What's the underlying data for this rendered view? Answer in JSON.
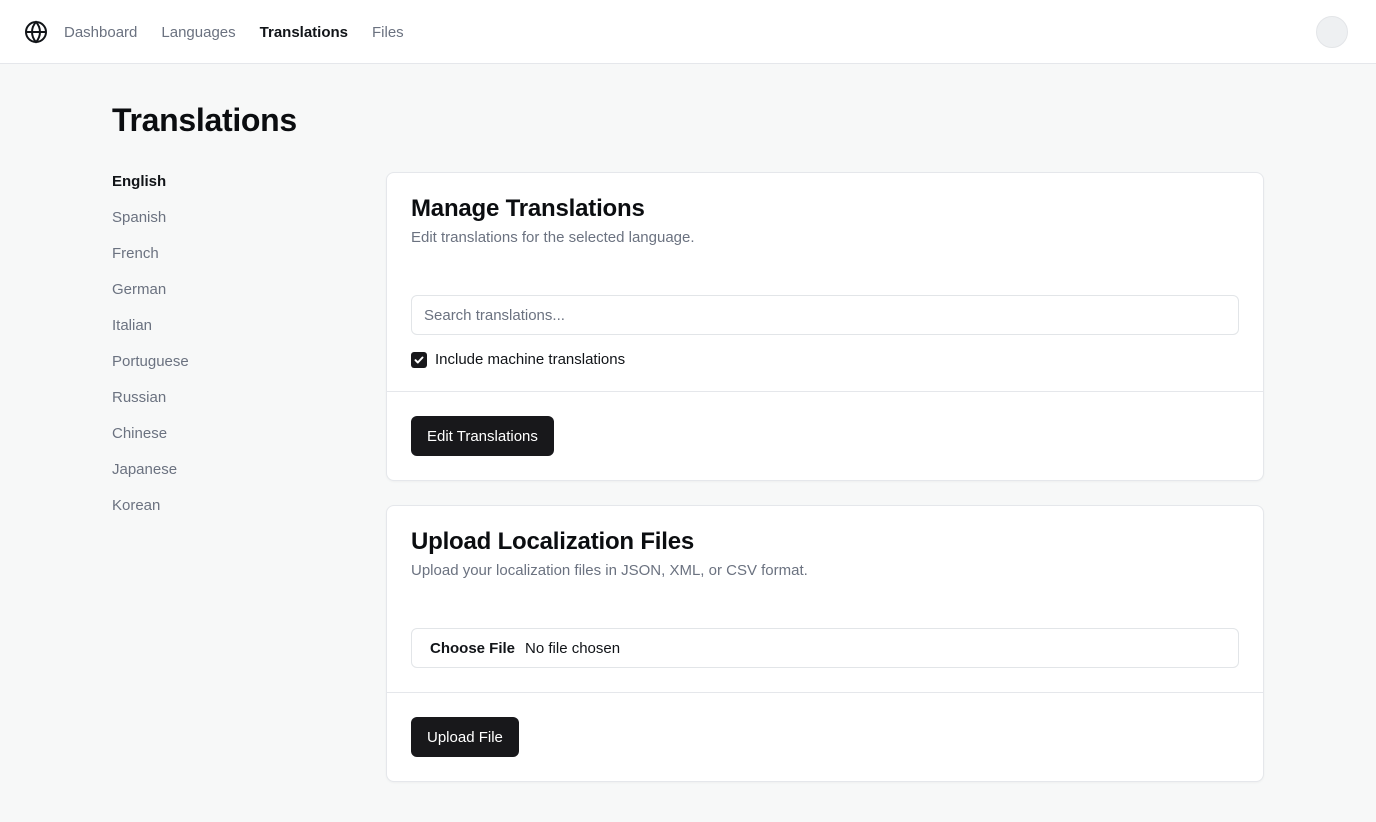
{
  "header": {
    "logo_icon": "globe-icon",
    "nav": [
      {
        "label": "Dashboard",
        "active": false
      },
      {
        "label": "Languages",
        "active": false
      },
      {
        "label": "Translations",
        "active": true
      },
      {
        "label": "Files",
        "active": false
      }
    ],
    "avatar_icon": "user-avatar"
  },
  "page": {
    "title": "Translations"
  },
  "sidebar": {
    "items": [
      {
        "label": "English",
        "active": true
      },
      {
        "label": "Spanish",
        "active": false
      },
      {
        "label": "French",
        "active": false
      },
      {
        "label": "German",
        "active": false
      },
      {
        "label": "Italian",
        "active": false
      },
      {
        "label": "Portuguese",
        "active": false
      },
      {
        "label": "Russian",
        "active": false
      },
      {
        "label": "Chinese",
        "active": false
      },
      {
        "label": "Japanese",
        "active": false
      },
      {
        "label": "Korean",
        "active": false
      }
    ]
  },
  "manage": {
    "title": "Manage Translations",
    "description": "Edit translations for the selected language.",
    "search_placeholder": "Search translations...",
    "search_value": "",
    "checkbox_label": "Include machine translations",
    "checkbox_checked": true,
    "button_label": "Edit Translations"
  },
  "upload": {
    "title": "Upload Localization Files",
    "description": "Upload your localization files in JSON, XML, or CSV format.",
    "choose_label": "Choose File",
    "file_status": "No file chosen",
    "button_label": "Upload File"
  },
  "colors": {
    "background": "#f7f8f8",
    "button": "#18181b",
    "muted_text": "#6b7280"
  }
}
